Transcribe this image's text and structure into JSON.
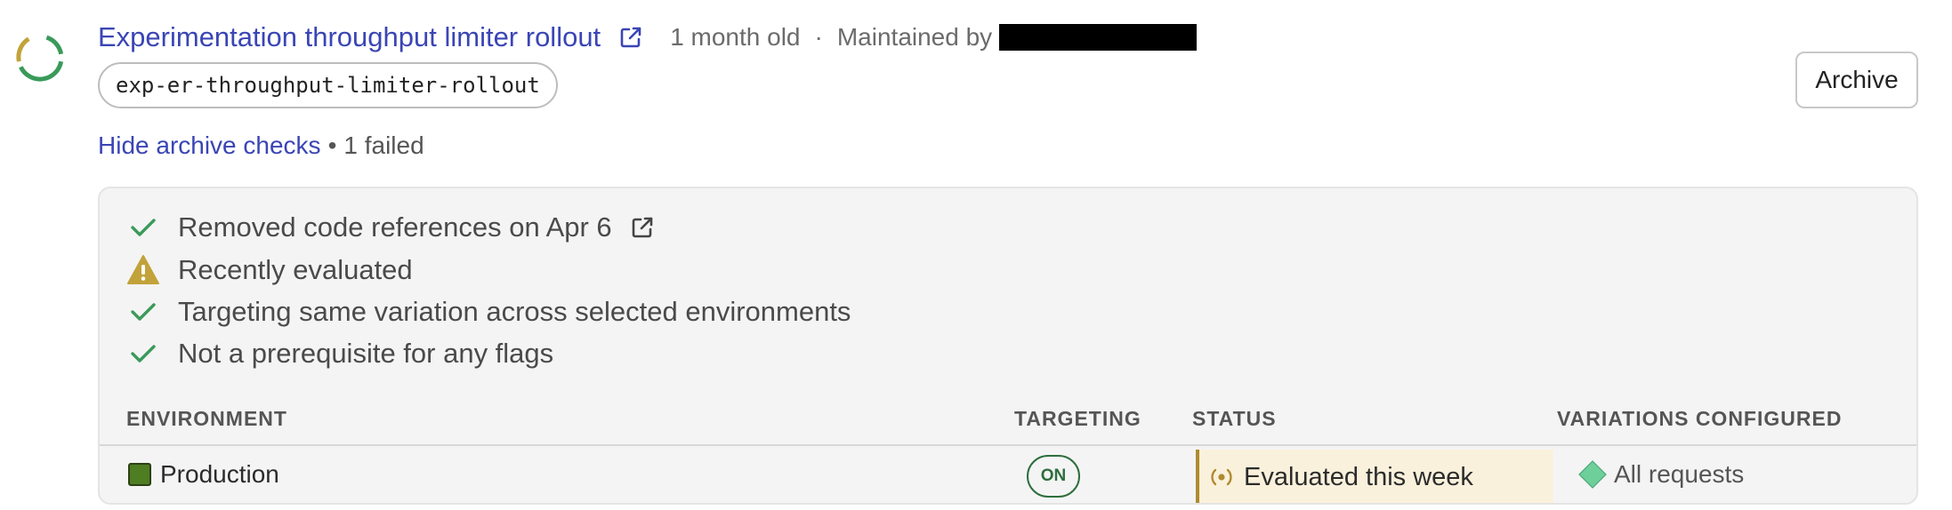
{
  "flag": {
    "title": "Experimentation throughput limiter rollout",
    "age": "1 month old",
    "separator": "·",
    "maintained_by_label": "Maintained by",
    "key": "exp-er-throughput-limiter-rollout"
  },
  "archive_button": {
    "label": "Archive"
  },
  "archive_checks": {
    "toggle_label": "Hide archive checks",
    "separator": "•",
    "failed_summary": "1 failed",
    "checks": [
      {
        "label": "Removed code references on Apr 6",
        "status": "passed",
        "icon": "checkmark-icon"
      },
      {
        "label": "Recently evaluated",
        "status": "warning",
        "icon": "warning-icon"
      },
      {
        "label": "Targeting same variation across selected environments",
        "status": "passed",
        "icon": "checkmark-icon"
      },
      {
        "label": "Not a prerequisite for any flags",
        "status": "passed",
        "icon": "checkmark-icon"
      }
    ]
  },
  "environments_table": {
    "headers": {
      "environment": "ENVIRONMENT",
      "targeting": "TARGETING",
      "status": "STATUS",
      "variations": "VARIATIONS CONFIGURED"
    },
    "rows": [
      {
        "environment": "Production",
        "environment_color": "#4f7d22",
        "targeting": "ON",
        "status": "Evaluated this week",
        "variations": "All requests"
      }
    ]
  },
  "colors": {
    "link": "#3a45b5",
    "success": "#3a9a5a",
    "warning": "#c2a23a",
    "on_badge": "#2e6e3e",
    "status_bg": "#faf1dc",
    "variation_diamond": "#6fcf9a"
  }
}
